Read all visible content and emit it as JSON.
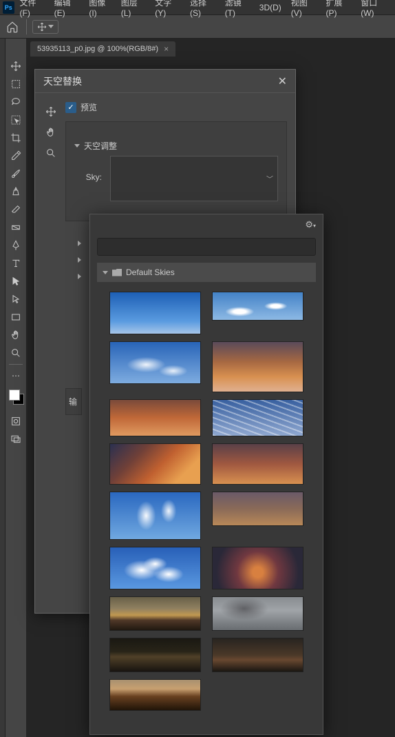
{
  "app_logo": "Ps",
  "menubar": {
    "file": "文件(F)",
    "edit": "编辑(E)",
    "image": "图像(I)",
    "layer": "图层(L)",
    "type": "文字(Y)",
    "select": "选择(S)",
    "filter": "滤镜(T)",
    "threeD": "3D(D)",
    "view": "视图(V)",
    "plugins": "扩展(P)",
    "window": "窗口(W)"
  },
  "document": {
    "tab_label": "53935113_p0.jpg @ 100%(RGB/8#)"
  },
  "dialog": {
    "title": "天空替换",
    "preview_label": "预览",
    "section_adjust": "天空调整",
    "sky_label": "Sky:",
    "output_label": "输"
  },
  "picker": {
    "folder_label": "Default Skies",
    "thumbs": [
      {
        "name": "blue-sky-1",
        "class": "blue1"
      },
      {
        "name": "blue-sky-2",
        "class": "blue2"
      },
      {
        "name": "clouds-1",
        "class": "clouds1"
      },
      {
        "name": "sunset-1",
        "class": "sunset1"
      },
      {
        "name": "sunset-2",
        "class": "sunset2"
      },
      {
        "name": "cirrus",
        "class": "cirrus"
      },
      {
        "name": "sunset-3",
        "class": "sunset3"
      },
      {
        "name": "sunset-4",
        "class": "sunset4"
      },
      {
        "name": "blue-sky-3",
        "class": "blue3"
      },
      {
        "name": "sunset-5",
        "class": "sunset5"
      },
      {
        "name": "cumulus",
        "class": "cumulus"
      },
      {
        "name": "sunset-6",
        "class": "sunset6"
      },
      {
        "name": "dusk-1",
        "class": "dusk1"
      },
      {
        "name": "storm",
        "class": "storm"
      },
      {
        "name": "night-1",
        "class": "night1"
      },
      {
        "name": "night-2",
        "class": "night2"
      },
      {
        "name": "dusk-2",
        "class": "dusk2"
      }
    ]
  }
}
